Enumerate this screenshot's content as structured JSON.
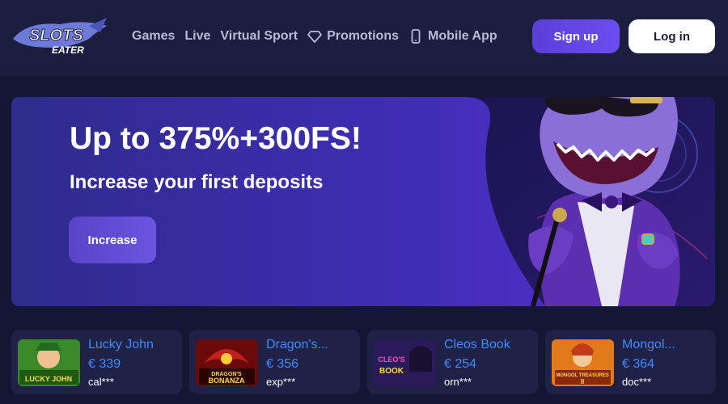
{
  "header": {
    "logo_text": "SLOTS EATER",
    "nav": [
      {
        "label": "Games",
        "icon": ""
      },
      {
        "label": "Live",
        "icon": ""
      },
      {
        "label": "Virtual Sport",
        "icon": ""
      },
      {
        "label": "Promotions",
        "icon": "diamond-icon"
      },
      {
        "label": "Mobile App",
        "icon": "phone-icon"
      }
    ],
    "signup_label": "Sign up",
    "login_label": "Log in"
  },
  "banner": {
    "title": "Up to 375%+300FS!",
    "subtitle": "Increase your first deposits",
    "button_label": "Increase"
  },
  "winners": [
    {
      "game": "Lucky John",
      "amount": "€ 339",
      "user": "cal***",
      "thumb_text": "LUCKY JOHN"
    },
    {
      "game": "Dragon's...",
      "amount": "€ 356",
      "user": "exp***",
      "thumb_text": "DRAGON'S BONANZA"
    },
    {
      "game": "Cleos Book",
      "amount": "€ 254",
      "user": "orn***",
      "thumb_text": "CLEO'S BOOK"
    },
    {
      "game": "Mongol...",
      "amount": "€ 364",
      "user": "doc***",
      "thumb_text": "MONGOL TREASURES II"
    }
  ],
  "colors": {
    "background": "#141733",
    "header": "#1b1e3e",
    "accent": "#6c4df0",
    "win_text": "#3f8bff"
  }
}
